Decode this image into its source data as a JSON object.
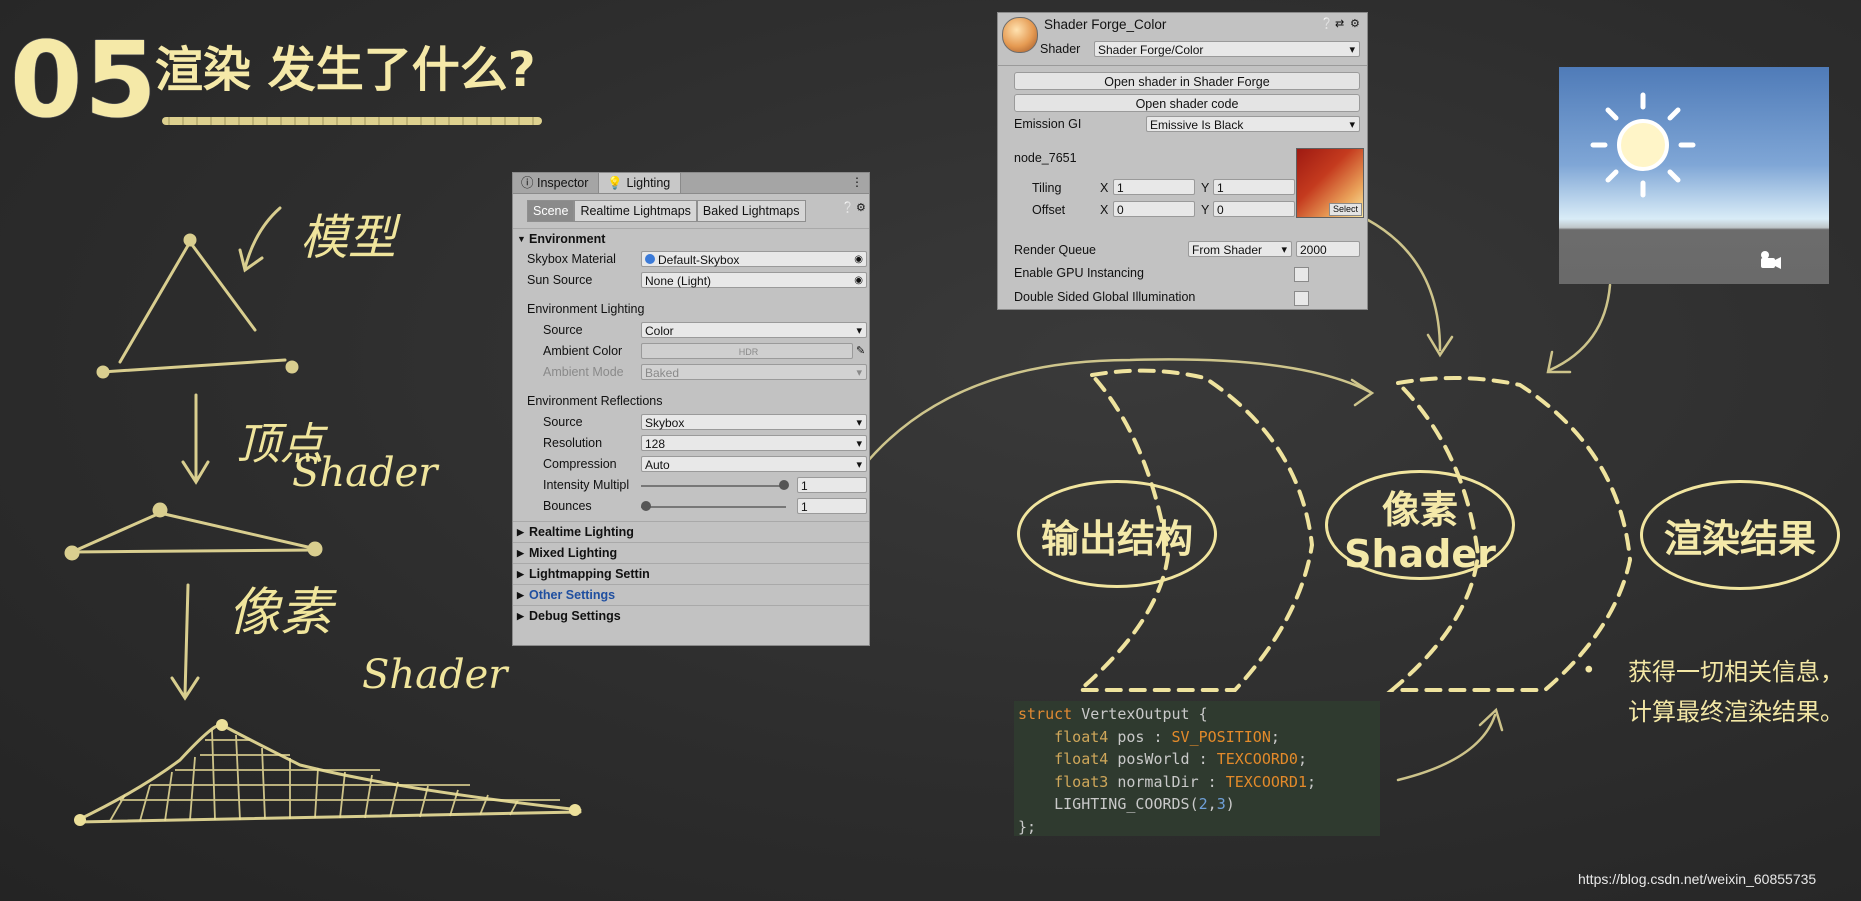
{
  "title": {
    "number": "05",
    "text": "渲染 发生了什么?"
  },
  "sketch": {
    "model_label": "模型",
    "vertex_label_cn": "顶点",
    "vertex_label_en": "Shader",
    "pixel_label_cn": "像素",
    "pixel_label_en": "Shader"
  },
  "inspector": {
    "tabs": [
      "Inspector",
      "Lighting"
    ],
    "subtabs": [
      "Scene",
      "Realtime Lightmaps",
      "Baked Lightmaps"
    ],
    "environment": {
      "header": "Environment",
      "skybox_material_label": "Skybox Material",
      "skybox_material_value": "Default-Skybox",
      "sun_source_label": "Sun Source",
      "sun_source_value": "None (Light)",
      "env_lighting_header": "Environment Lighting",
      "source_label": "Source",
      "source_value": "Color",
      "ambient_color_label": "Ambient Color",
      "ambient_color_value": "HDR",
      "ambient_mode_label": "Ambient Mode",
      "ambient_mode_value": "Baked",
      "env_reflections_header": "Environment Reflections",
      "refl_source_label": "Source",
      "refl_source_value": "Skybox",
      "resolution_label": "Resolution",
      "resolution_value": "128",
      "compression_label": "Compression",
      "compression_value": "Auto",
      "intensity_label": "Intensity Multipl",
      "intensity_value": "1",
      "bounces_label": "Bounces",
      "bounces_value": "1"
    },
    "sections": [
      "Realtime Lighting",
      "Mixed Lighting",
      "Lightmapping Settin",
      "Other Settings",
      "Debug Settings"
    ]
  },
  "shader_panel": {
    "title": "Shader Forge_Color",
    "shader_label": "Shader",
    "shader_value": "Shader Forge/Color",
    "open_forge_button": "Open shader in Shader Forge",
    "open_code_button": "Open shader code",
    "emission_gi_label": "Emission GI",
    "emission_gi_value": "Emissive Is Black",
    "node_label": "node_7651",
    "tiling_label": "Tiling",
    "offset_label": "Offset",
    "x_label": "X",
    "y_label": "Y",
    "tiling_x": "1",
    "tiling_y": "1",
    "offset_x": "0",
    "offset_y": "0",
    "select_label": "Select",
    "render_queue_label": "Render Queue",
    "render_queue_mode": "From Shader",
    "render_queue_value": "2000",
    "gpu_instancing_label": "Enable GPU Instancing",
    "double_sided_gi_label": "Double Sided Global Illumination"
  },
  "flow": {
    "output_struct": "输出结构",
    "pixel_cn": "像素",
    "pixel_en": "Shader",
    "result": "渲染结果"
  },
  "code": {
    "line1_kw": "struct",
    "line1_rest": " VertexOutput {",
    "line2_type": "float4",
    "line2_name": " pos : ",
    "line2_sem": "SV_POSITION",
    "line3_type": "float4",
    "line3_name": " posWorld : ",
    "line3_sem": "TEXCOORD0",
    "line4_type": "float3",
    "line4_name": " normalDir : ",
    "line4_sem": "TEXCOORD1",
    "line5_call": "LIGHTING_COORDS(",
    "line5_a": "2",
    "line5_b": "3",
    "line6": "};"
  },
  "note": {
    "bullet": "•",
    "text": "获得一切相关信息，计算最终渲染结果。"
  },
  "watermark": "https://blog.csdn.net/weixin_60855735",
  "colors": {
    "chalk": "#f2e6a0",
    "board": "#2c2c2c",
    "panel": "#c2c2c2",
    "link": "#1f4fa0"
  }
}
